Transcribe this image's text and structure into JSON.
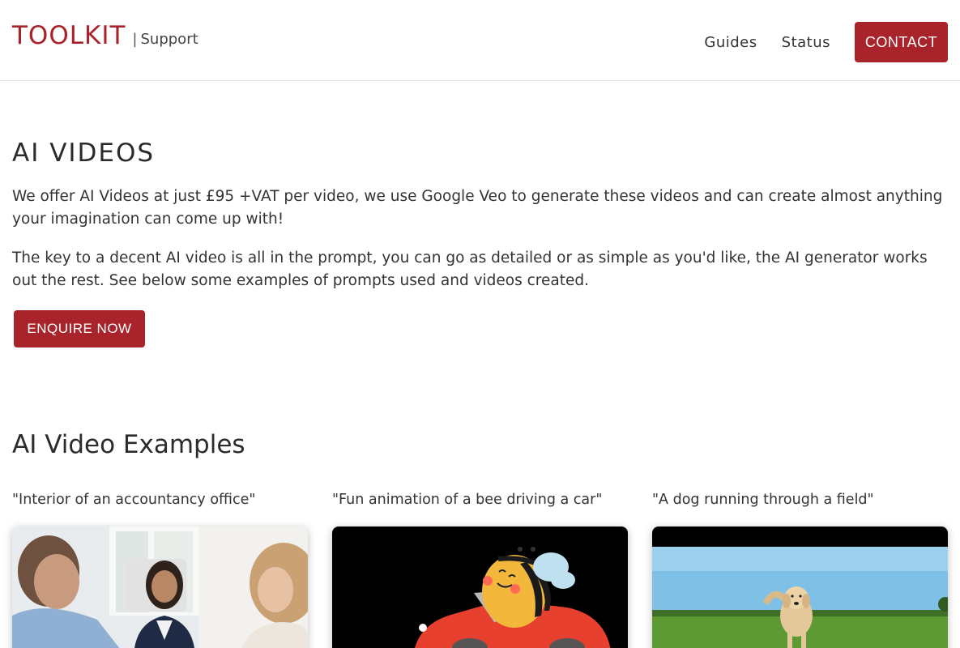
{
  "header": {
    "logo_main": "TOOLKIT",
    "logo_sep": "|",
    "logo_sub": "Support",
    "nav": [
      {
        "label": "Guides"
      },
      {
        "label": "Status"
      }
    ],
    "contact_label": "CONTACT"
  },
  "hero": {
    "title": "AI VIDEOS",
    "paragraph1": "We offer AI Videos at just £95 +VAT per video, we use Google Veo to generate these videos and can create almost anything your imagination can come up with!",
    "paragraph2": "The key to a decent AI video is all in the prompt, you can go as detailed or as simple as you'd like, the AI generator works out the rest. See below some examples of prompts used and videos created.",
    "enquire_label": "ENQUIRE NOW"
  },
  "examples": {
    "title": "AI Video Examples",
    "items": [
      {
        "caption": "\"Interior of an accountancy office\""
      },
      {
        "caption": "\"Fun animation of a bee driving a car\""
      },
      {
        "caption": "\"A dog running through a field\""
      }
    ]
  },
  "colors": {
    "brand": "#a8232a"
  }
}
